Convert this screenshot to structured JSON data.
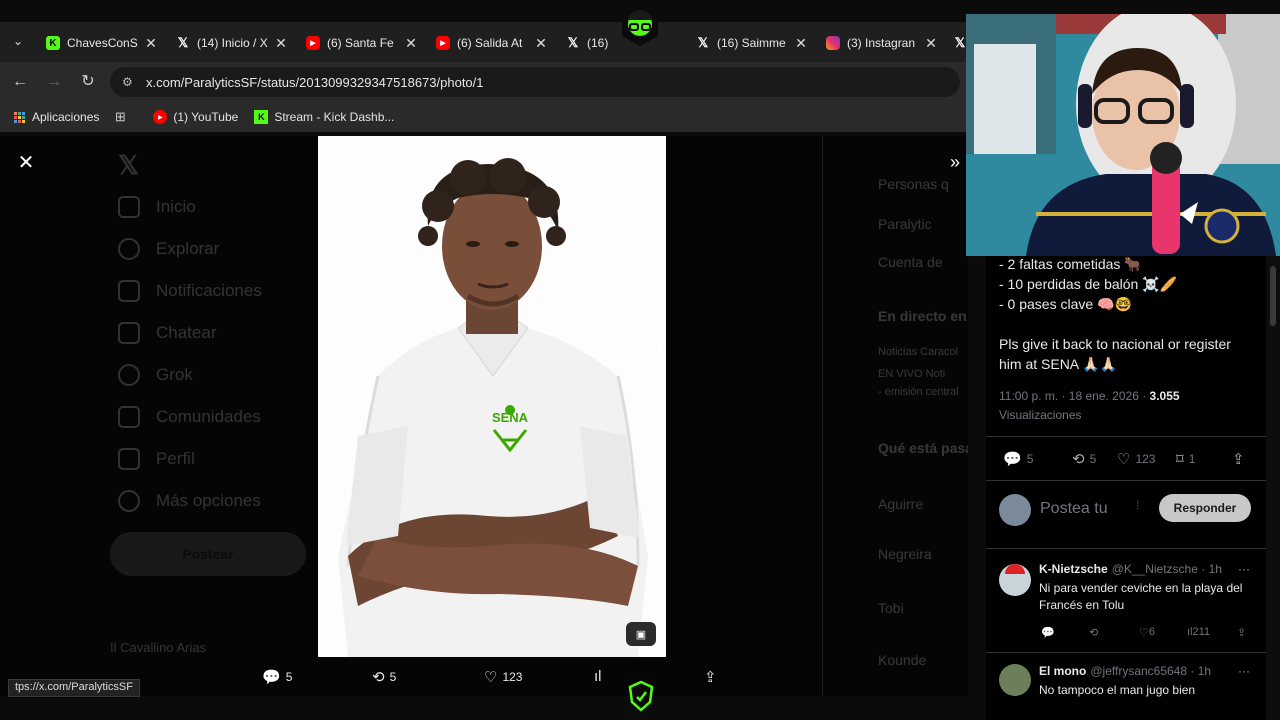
{
  "browser": {
    "tabs": [
      {
        "title": "ChavesConS",
        "icon": "kick-icon",
        "color": "#53fc18"
      },
      {
        "title": "(14) Inicio / X",
        "icon": "x-icon",
        "color": "#ffffff"
      },
      {
        "title": "(6) Santa Fe",
        "icon": "youtube-icon",
        "color": "#ff0000"
      },
      {
        "title": "(6) Salida At",
        "icon": "youtube-icon",
        "color": "#ff0000"
      },
      {
        "title": "(16)",
        "icon": "x-icon",
        "color": "#ffffff"
      },
      {
        "title": "(16) Saimme",
        "icon": "x-icon",
        "color": "#ffffff"
      },
      {
        "title": "(3) Instagran",
        "icon": "instagram-icon",
        "color": "#e1306c"
      }
    ],
    "url": "x.com/ParalyticsSF/status/2013099329347518673/photo/1",
    "bookmarks": [
      {
        "label": "Aplicaciones",
        "icon": "apps-grid-icon"
      },
      {
        "label": "(1) YouTube",
        "icon": "youtube-icon"
      },
      {
        "label": "Stream - Kick Dashb...",
        "icon": "kick-icon"
      }
    ],
    "status_url": "tps://x.com/ParalyticsSF"
  },
  "x_nav": {
    "items": [
      "Inicio",
      "Explorar",
      "Notificaciones",
      "Chatear",
      "Grok",
      "Comunidades",
      "Perfil",
      "Más opciones"
    ],
    "post_button": "Postear",
    "account": "Il Cavallino Arias"
  },
  "x_side": [
    "Personas q",
    "Paralytic",
    "Cuenta de",
    "En directo en",
    "Noticias Caracol",
    "EN VIVO Noti",
    "- emisión central",
    "Qué está pasa",
    "Aguirre",
    "Negreira",
    "Tobi",
    "Kounde"
  ],
  "media": {
    "actions": {
      "replies": "5",
      "reposts": "5",
      "likes": "123"
    },
    "alt_button_icon": "alt-text-icon"
  },
  "tweet": {
    "lines": [
      "- 2 faltas cometidas 🐂",
      "- 10 perdidas de balón ☠️🥖",
      "- 0 pases clave 🧠🤓",
      "",
      "Pls give it back to nacional or register",
      "him at SENA 🙏🏻🙏🏻"
    ],
    "time": "11:00 p. m. · 18 ene. 2026 · ",
    "views_count": "3.055",
    "views_label": "Visualizaciones",
    "stats": {
      "replies": "5",
      "reposts": "5",
      "likes": "123",
      "bookmarks": "1"
    },
    "reply_placeholder": "Postea tu",
    "reply_button": "Responder"
  },
  "replies": [
    {
      "name": "K-Nietzsche",
      "handle": "@K__Nietzsche · 1h",
      "text": "Ni para vender ceviche en la playa del Francés en Tolu",
      "stats": {
        "replies": "",
        "reposts": "",
        "likes": "6",
        "views": "211"
      }
    },
    {
      "name": "El mono",
      "handle": "@jeffrysanc65648 · 1h",
      "text": "No tampoco el man jugo bien",
      "stats": {
        "replies": "",
        "reposts": "",
        "likes": "",
        "views": ""
      }
    }
  ],
  "colors": {
    "accent": "#1d9bf0",
    "sena_green": "#39a900",
    "kick_green": "#53fc18"
  }
}
